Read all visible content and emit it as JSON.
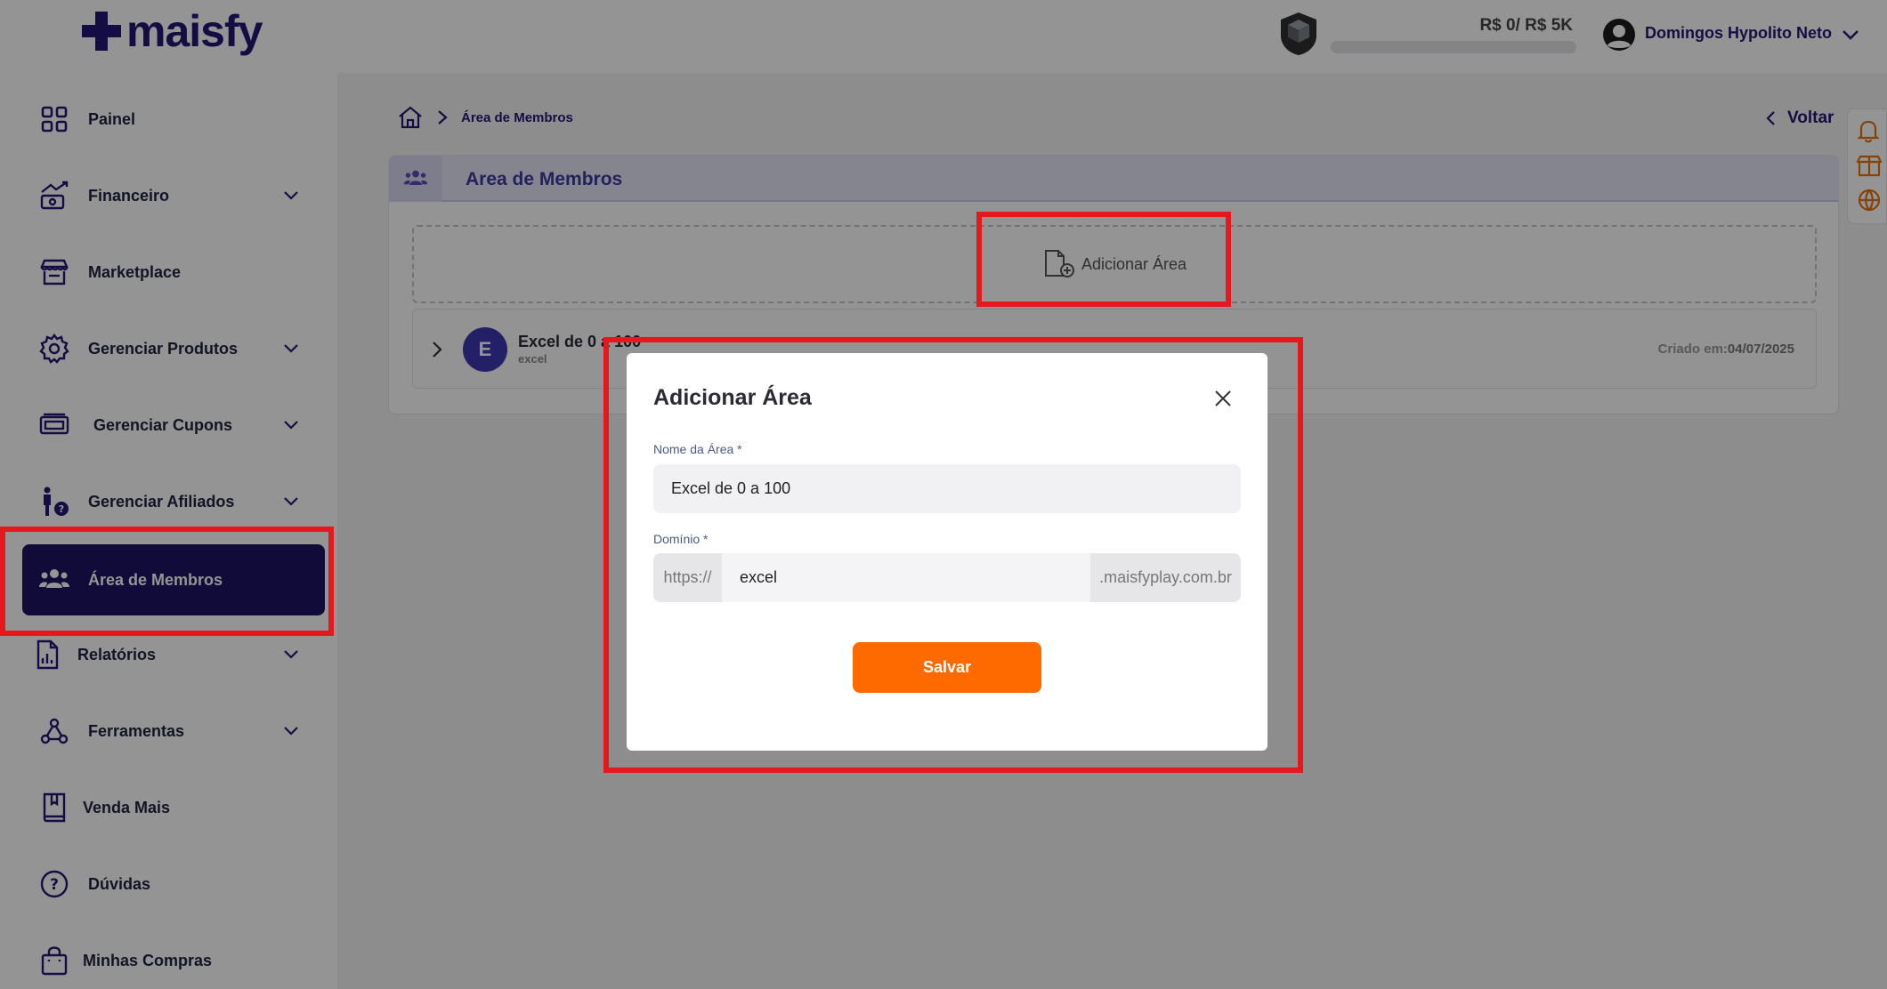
{
  "header": {
    "logo_text": "maisfy",
    "revenue": "R$ 0/ R$ 5K",
    "revenue_progress": 0,
    "user_name": "Domingos Hypolito Neto"
  },
  "sidebar": {
    "items": [
      {
        "label": "Painel"
      },
      {
        "label": "Financeiro"
      },
      {
        "label": "Marketplace"
      },
      {
        "label": "Gerenciar Produtos"
      },
      {
        "label": "Gerenciar Cupons"
      },
      {
        "label": "Gerenciar Afiliados"
      },
      {
        "label": "Área de Membros"
      },
      {
        "label": "Relatórios"
      },
      {
        "label": "Ferramentas"
      },
      {
        "label": "Venda Mais"
      },
      {
        "label": "Dúvidas"
      },
      {
        "label": "Minhas Compras"
      }
    ]
  },
  "breadcrumb": {
    "current": "Área de Membros"
  },
  "back_label": "Voltar",
  "card": {
    "title": "Area de Membros",
    "add_label": "Adicionar Área",
    "row": {
      "initial": "E",
      "name": "Excel de 0 a 100",
      "subdomain": "excel",
      "created_label": "Criado em:",
      "created_date": "04/07/2025"
    }
  },
  "modal": {
    "title": "Adicionar Área",
    "name_label": "Nome da Área *",
    "name_value": "Excel de 0 a 100",
    "domain_label": "Domínio *",
    "domain_prefix": "https://",
    "domain_value": "excel",
    "domain_suffix": ".maisfyplay.com.br",
    "save_label": "Salvar"
  },
  "colors": {
    "brand": "#241874",
    "active_nav": "#1e1363",
    "accent": "#ff6a00",
    "highlight": "#e5181e"
  }
}
